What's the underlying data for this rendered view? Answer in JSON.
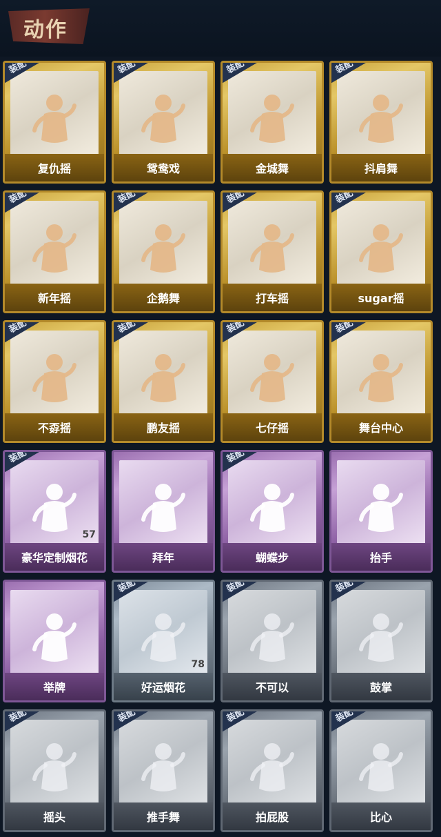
{
  "header": {
    "title": "动作"
  },
  "equip_label": "装配",
  "cards": [
    {
      "label": "复仇摇",
      "tier": "gold",
      "equipped": true,
      "icon": "dancer-icon"
    },
    {
      "label": "鸳鸯戏",
      "tier": "gold",
      "equipped": true,
      "icon": "dancer-icon"
    },
    {
      "label": "金城舞",
      "tier": "gold",
      "equipped": true,
      "icon": "dancer-icon"
    },
    {
      "label": "抖肩舞",
      "tier": "gold",
      "equipped": true,
      "icon": "dancer-icon"
    },
    {
      "label": "新年摇",
      "tier": "gold",
      "equipped": true,
      "icon": "dancer-icon"
    },
    {
      "label": "企鹅舞",
      "tier": "gold",
      "equipped": true,
      "icon": "dancer-icon"
    },
    {
      "label": "打车摇",
      "tier": "gold",
      "equipped": true,
      "icon": "dancer-icon"
    },
    {
      "label": "sugar摇",
      "tier": "gold",
      "equipped": true,
      "icon": "dancer-icon"
    },
    {
      "label": "不孬摇",
      "tier": "gold",
      "equipped": true,
      "icon": "dancer-icon"
    },
    {
      "label": "鹏友摇",
      "tier": "gold",
      "equipped": true,
      "icon": "dancer-icon"
    },
    {
      "label": "七仔摇",
      "tier": "gold",
      "equipped": true,
      "icon": "dancer-icon"
    },
    {
      "label": "舞台中心",
      "tier": "gold",
      "equipped": true,
      "icon": "dancer-icon"
    },
    {
      "label": "豪华定制烟花",
      "tier": "purple",
      "equipped": true,
      "icon": "fireworks-box-icon",
      "count": "57"
    },
    {
      "label": "拜年",
      "tier": "purple",
      "equipped": false,
      "icon": "bow-icon"
    },
    {
      "label": "蝴蝶步",
      "tier": "purple",
      "equipped": true,
      "icon": "dancer-icon"
    },
    {
      "label": "抬手",
      "tier": "purple",
      "equipped": false,
      "icon": "raise-hand-icon"
    },
    {
      "label": "举牌",
      "tier": "purple",
      "equipped": false,
      "icon": "sign-icon"
    },
    {
      "label": "好运烟花",
      "tier": "silver",
      "equipped": true,
      "icon": "firework-tube-icon",
      "count": "78"
    },
    {
      "label": "不可以",
      "tier": "gray",
      "equipped": true,
      "icon": "finger-wag-icon"
    },
    {
      "label": "鼓掌",
      "tier": "gray",
      "equipped": true,
      "icon": "clap-icon"
    },
    {
      "label": "摇头",
      "tier": "gray",
      "equipped": true,
      "icon": "head-shake-icon"
    },
    {
      "label": "推手舞",
      "tier": "gray",
      "equipped": true,
      "icon": "push-hand-icon"
    },
    {
      "label": "拍屁股",
      "tier": "gray",
      "equipped": true,
      "icon": "butt-slap-icon"
    },
    {
      "label": "比心",
      "tier": "gray",
      "equipped": true,
      "icon": "heart-hand-icon"
    }
  ]
}
